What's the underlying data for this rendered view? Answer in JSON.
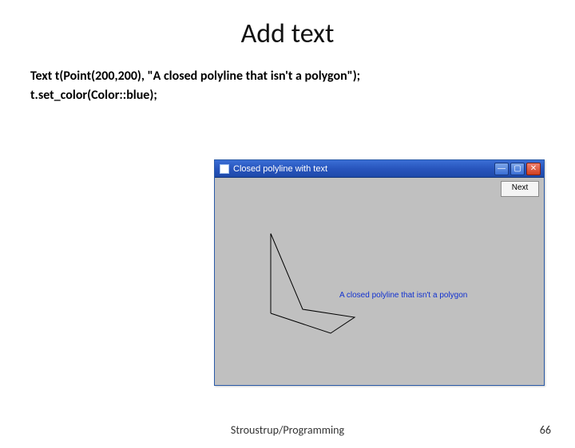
{
  "slide": {
    "title": "Add text",
    "code_line1": "Text t(Point(200,200), \"A closed polyline that isn't a polygon\");",
    "code_line2": "t.set_color(Color::blue);",
    "footer": "Stroustrup/Programming",
    "page_number": "66"
  },
  "window": {
    "title": "Closed polyline with text",
    "next_button": "Next",
    "canvas_text": "A closed polyline that isn't a polygon",
    "min_glyph": "—",
    "max_glyph": "▢",
    "close_glyph": "✕"
  }
}
